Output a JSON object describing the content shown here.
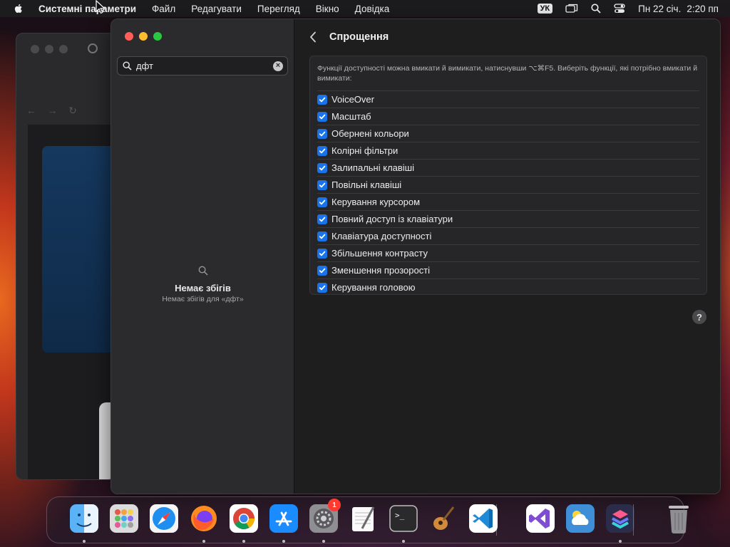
{
  "menubar": {
    "app_name": "Системні параметри",
    "items": [
      "Файл",
      "Редагувати",
      "Перегляд",
      "Вікно",
      "Довідка"
    ],
    "input_source": "УК",
    "date": "Пн 22 січ.",
    "time": "2:20 пп"
  },
  "sidebar": {
    "search": {
      "value": "дфт",
      "clear_label": "×"
    },
    "no_results": {
      "title": "Немає збігів",
      "subtitle": "Немає збігів для «дфт»"
    }
  },
  "main": {
    "title": "Спрощення",
    "description": "Функції доступності можна вмикати й вимикати, натиснувши ⌥⌘F5. Виберіть функції, які потрібно вмикати й вимикати:",
    "options": [
      {
        "label": "VoiceOver",
        "checked": true
      },
      {
        "label": "Масштаб",
        "checked": true
      },
      {
        "label": "Обернені кольори",
        "checked": true
      },
      {
        "label": "Колірні фільтри",
        "checked": true
      },
      {
        "label": "Залипальні клавіші",
        "checked": true
      },
      {
        "label": "Повільні клавіші",
        "checked": true
      },
      {
        "label": "Керування курсором",
        "checked": true
      },
      {
        "label": "Повний доступ із клавіатури",
        "checked": true
      },
      {
        "label": "Клавіатура доступності",
        "checked": true
      },
      {
        "label": "Збільшення контрасту",
        "checked": true
      },
      {
        "label": "Зменшення прозорості",
        "checked": true
      },
      {
        "label": "Керування головою",
        "checked": true
      }
    ],
    "help_label": "?"
  },
  "dock": {
    "apps": [
      {
        "name": "Finder",
        "icon": "finder-icon",
        "color": "#2f9bf0",
        "running": true
      },
      {
        "name": "Launchpad",
        "icon": "launchpad-icon",
        "color": "#d9d9d9",
        "running": false
      },
      {
        "name": "Safari",
        "icon": "safari-icon",
        "color": "#1e88f0",
        "running": false
      },
      {
        "name": "Firefox",
        "icon": "firefox-icon",
        "color": "#ff7a18",
        "running": true
      },
      {
        "name": "Chrome",
        "icon": "chrome-icon",
        "color": "#ffffff",
        "running": true
      },
      {
        "name": "App Store",
        "icon": "app-store-icon",
        "color": "#1a8cff",
        "running": true
      },
      {
        "name": "System Settings",
        "icon": "system-settings-icon",
        "color": "#8e8e93",
        "running": true,
        "badge": "1"
      },
      {
        "name": "TextEdit",
        "icon": "textedit-icon",
        "color": "#f2f2f2",
        "running": false
      },
      {
        "name": "Terminal",
        "icon": "terminal-icon",
        "color": "#1c1c1e",
        "running": true
      },
      {
        "name": "GarageBand",
        "icon": "garageband-icon",
        "color": "#3a2a1c",
        "running": false
      },
      {
        "name": "Visual Studio Code",
        "icon": "vscode-icon",
        "color": "#ffffff",
        "running": false
      },
      {
        "name": "Visual Studio",
        "icon": "visual-studio-icon",
        "color": "#ffffff",
        "running": false
      },
      {
        "name": "Weather",
        "icon": "weather-icon",
        "color": "#3e8fd8",
        "running": false
      },
      {
        "name": "Shortcuts",
        "icon": "shortcuts-icon",
        "color": "#2b2b4a",
        "running": true
      },
      {
        "name": "Trash",
        "icon": "trash-icon",
        "color": "#9a9a9e",
        "running": false
      }
    ]
  },
  "colors": {
    "accent": "#1a73e8",
    "close": "#ff5f57",
    "minimize": "#febc2e",
    "zoom": "#28c840",
    "badge": "#ff3b30"
  }
}
